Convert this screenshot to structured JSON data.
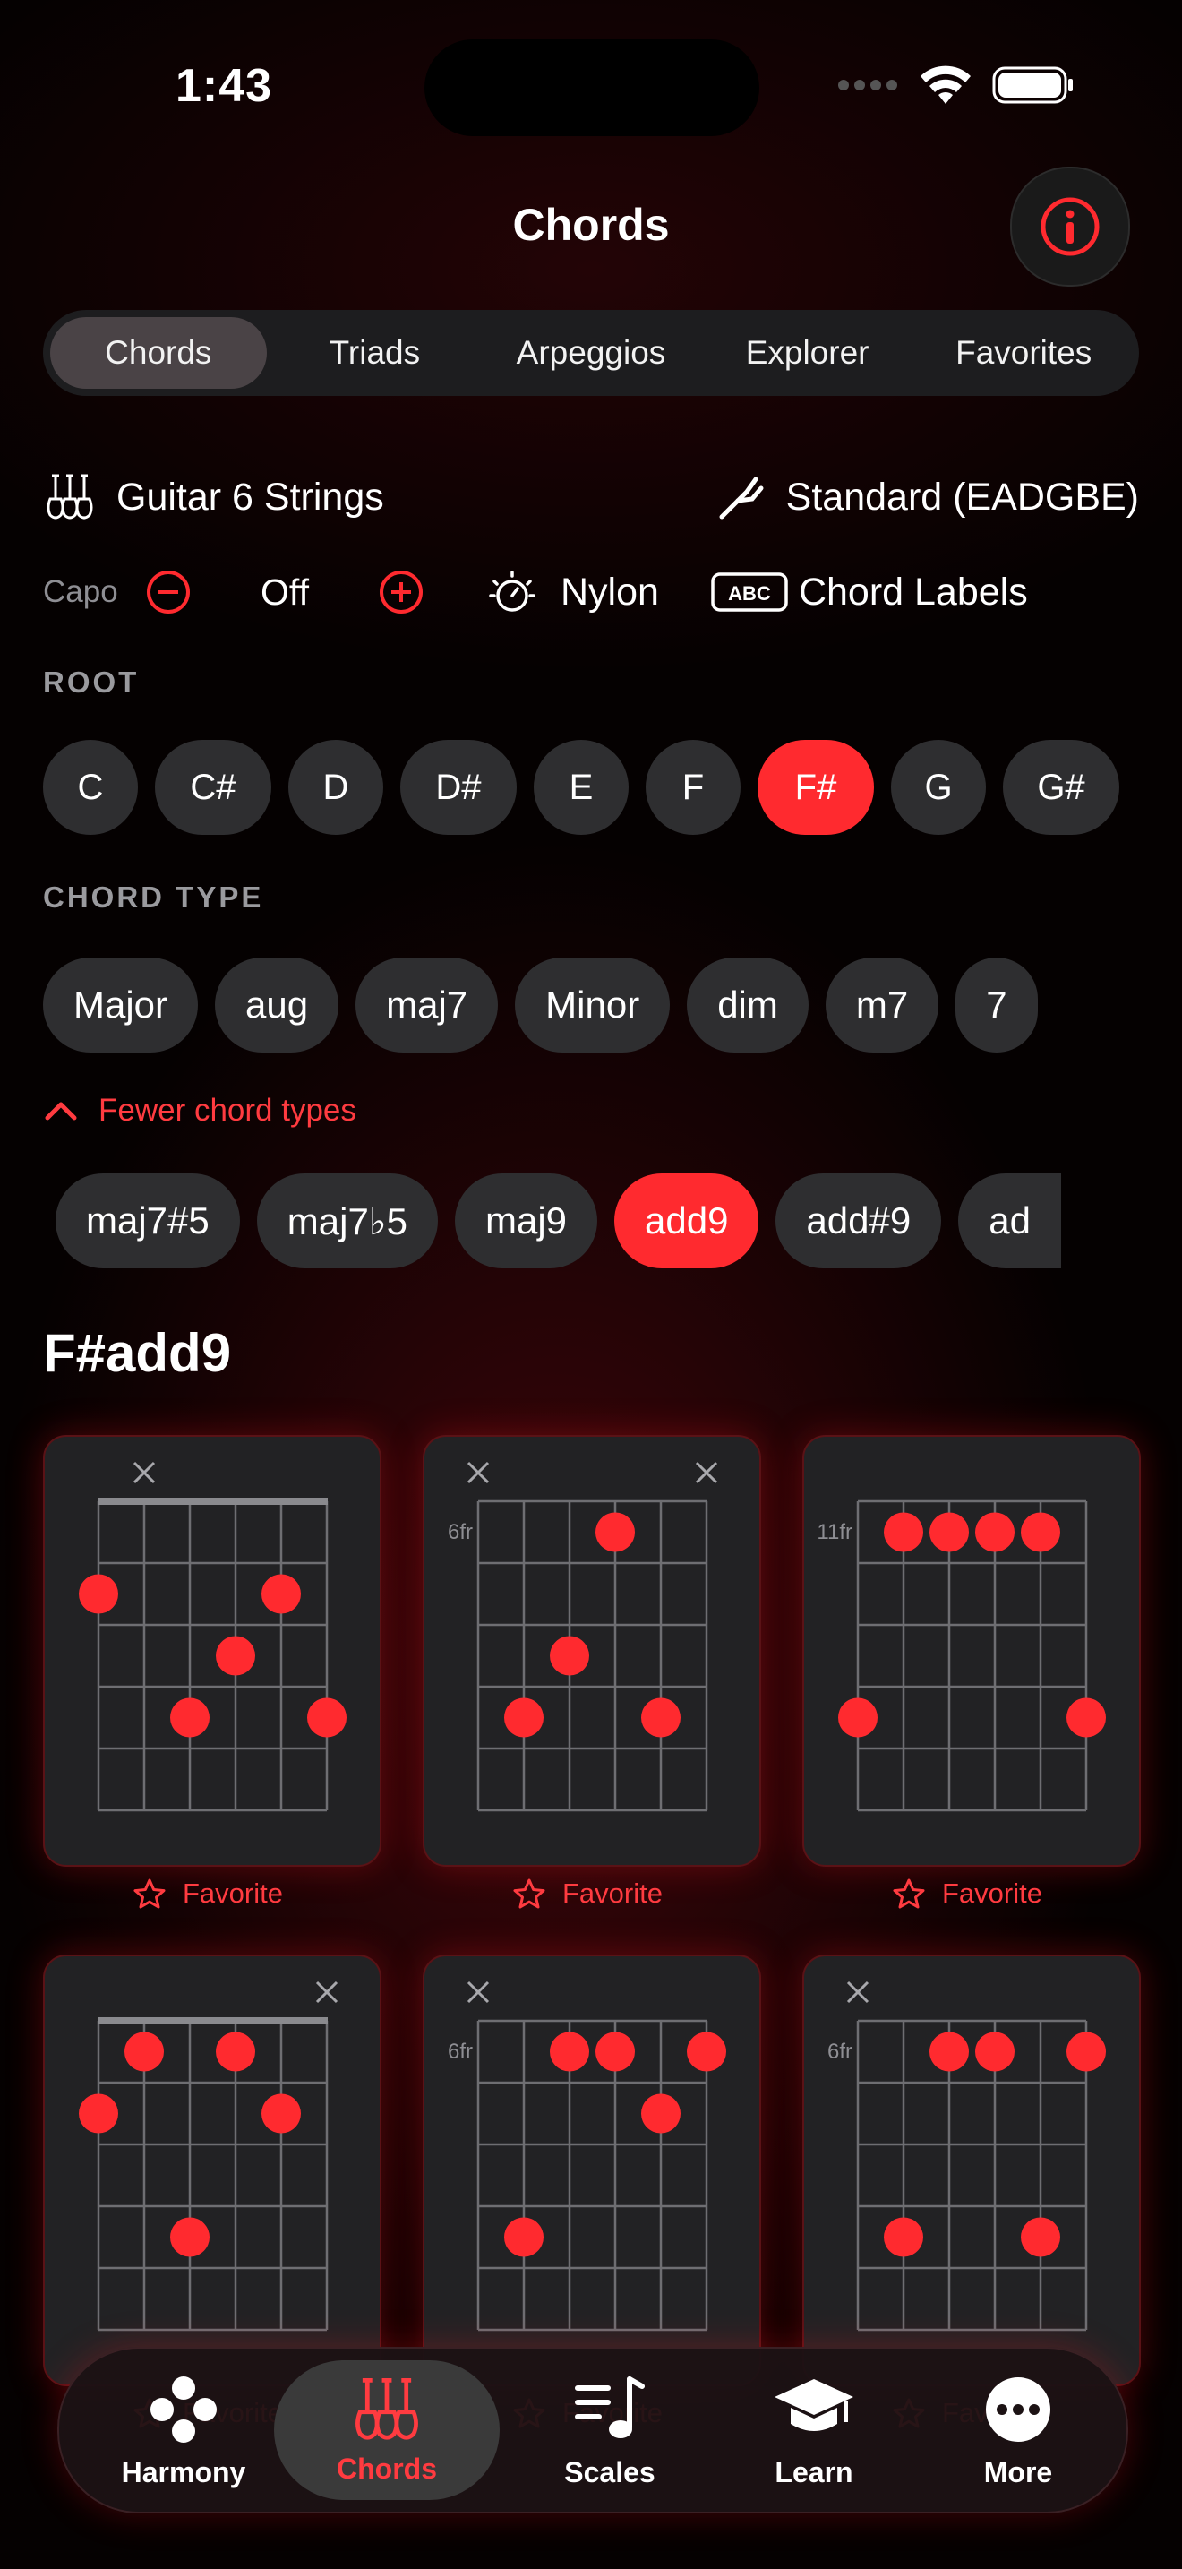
{
  "status": {
    "time": "1:43"
  },
  "nav": {
    "title": "Chords"
  },
  "segments": [
    "Chords",
    "Triads",
    "Arpeggios",
    "Explorer",
    "Favorites"
  ],
  "instrument": "Guitar 6 Strings",
  "tuning": "Standard (EADGBE)",
  "capo": {
    "label": "Capo",
    "value": "Off"
  },
  "sound": "Nylon",
  "labels_toggle": "Chord Labels",
  "root": {
    "label": "ROOT",
    "notes": [
      "C",
      "C#",
      "D",
      "D#",
      "E",
      "F",
      "F#",
      "G",
      "G#"
    ],
    "selected": "F#"
  },
  "chord_type": {
    "label": "CHORD TYPE",
    "primary": [
      "Major",
      "aug",
      "maj7",
      "Minor",
      "dim",
      "m7",
      "7"
    ],
    "toggle": "Fewer chord types",
    "extended": [
      "maj7#5",
      "maj7♭5",
      "maj9",
      "add9",
      "add#9",
      "ad"
    ],
    "selected": "add9"
  },
  "chord_name": "F#add9",
  "favorite_label": "Favorite",
  "diagrams": [
    {
      "fret_label": "",
      "muted": [
        1
      ],
      "nut": true,
      "dots": [
        [
          0,
          2
        ],
        [
          4,
          2
        ],
        [
          3,
          3
        ],
        [
          2,
          4
        ],
        [
          5,
          4
        ]
      ]
    },
    {
      "fret_label": "6fr",
      "muted": [
        0,
        5
      ],
      "nut": false,
      "dots": [
        [
          3,
          1
        ],
        [
          2,
          3
        ],
        [
          1,
          4
        ],
        [
          4,
          4
        ]
      ]
    },
    {
      "fret_label": "11fr",
      "muted": [],
      "nut": false,
      "dots": [
        [
          1,
          1
        ],
        [
          2,
          1
        ],
        [
          3,
          1
        ],
        [
          4,
          1
        ],
        [
          0,
          4
        ],
        [
          5,
          4
        ]
      ]
    },
    {
      "fret_label": "",
      "muted": [
        5
      ],
      "nut": true,
      "dots": [
        [
          1,
          1
        ],
        [
          3,
          1
        ],
        [
          0,
          2
        ],
        [
          4,
          2
        ],
        [
          2,
          4
        ]
      ]
    },
    {
      "fret_label": "6fr",
      "muted": [
        0
      ],
      "nut": false,
      "dots": [
        [
          2,
          1
        ],
        [
          3,
          1
        ],
        [
          5,
          1
        ],
        [
          4,
          2
        ],
        [
          1,
          4
        ]
      ]
    },
    {
      "fret_label": "6fr",
      "muted": [
        0
      ],
      "nut": false,
      "dots": [
        [
          2,
          1
        ],
        [
          3,
          1
        ],
        [
          5,
          1
        ],
        [
          1,
          4
        ],
        [
          4,
          4
        ]
      ]
    }
  ],
  "tabs": [
    "Harmony",
    "Chords",
    "Scales",
    "Learn",
    "More"
  ],
  "active_tab": "Chords",
  "colors": {
    "accent": "#ff2a2f",
    "chip": "#2e2e30",
    "card": "#222224"
  }
}
